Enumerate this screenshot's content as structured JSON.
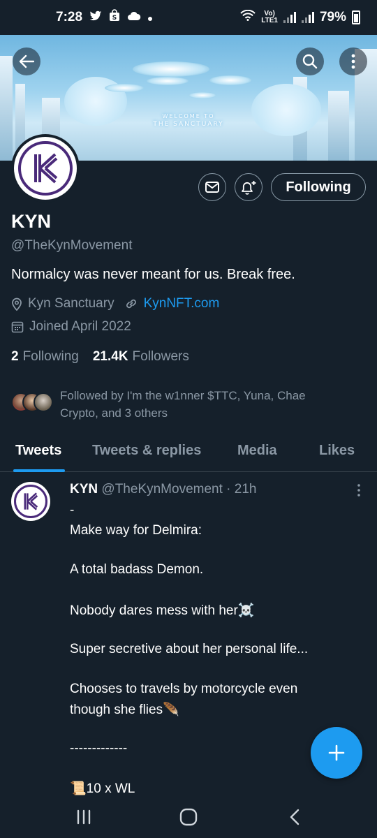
{
  "status_bar": {
    "time": "7:28",
    "battery": "79%",
    "network": [
      "Vo)",
      "LTE1"
    ],
    "icons": [
      "twitter-icon",
      "shopping-icon",
      "cloud-icon",
      "dot-icon",
      "wifi-icon",
      "signal-icon",
      "battery-icon"
    ]
  },
  "banner": {
    "line1": "WELCOME TO",
    "line2": "THE SANCTUARY"
  },
  "profile": {
    "name": "KYN",
    "handle": "@TheKynMovement",
    "bio": "Normalcy was never meant for us. Break free.",
    "location": "Kyn Sanctuary",
    "website": "KynNFT.com",
    "joined": "Joined April 2022",
    "following_count": "2",
    "following_label": "Following",
    "followers_count": "21.4K",
    "followers_label": "Followers",
    "followed_by_line1": "Followed by I'm the w1nner $TTC, Yuna, Chae",
    "followed_by_line2": "Crypto, and 3 others",
    "follow_button": "Following"
  },
  "tabs": [
    "Tweets",
    "Tweets & replies",
    "Media",
    "Likes"
  ],
  "active_tab": "Tweets",
  "tweet": {
    "author": "KYN",
    "handle": "@TheKynMovement",
    "time": "· 21h",
    "lines": [
      "-",
      "Make way for Delmira:",
      "A total badass Demon.",
      "Nobody dares mess with her☠️",
      "Super secretive about her personal life...",
      "Chooses to travels by motorcycle even",
      "though she flies🪶",
      "-------------",
      "📜10 x WL"
    ]
  },
  "colors": {
    "background": "#15202b",
    "accent": "#1d9bf0",
    "secondary_text": "#8b98a5",
    "border": "#38444d"
  }
}
